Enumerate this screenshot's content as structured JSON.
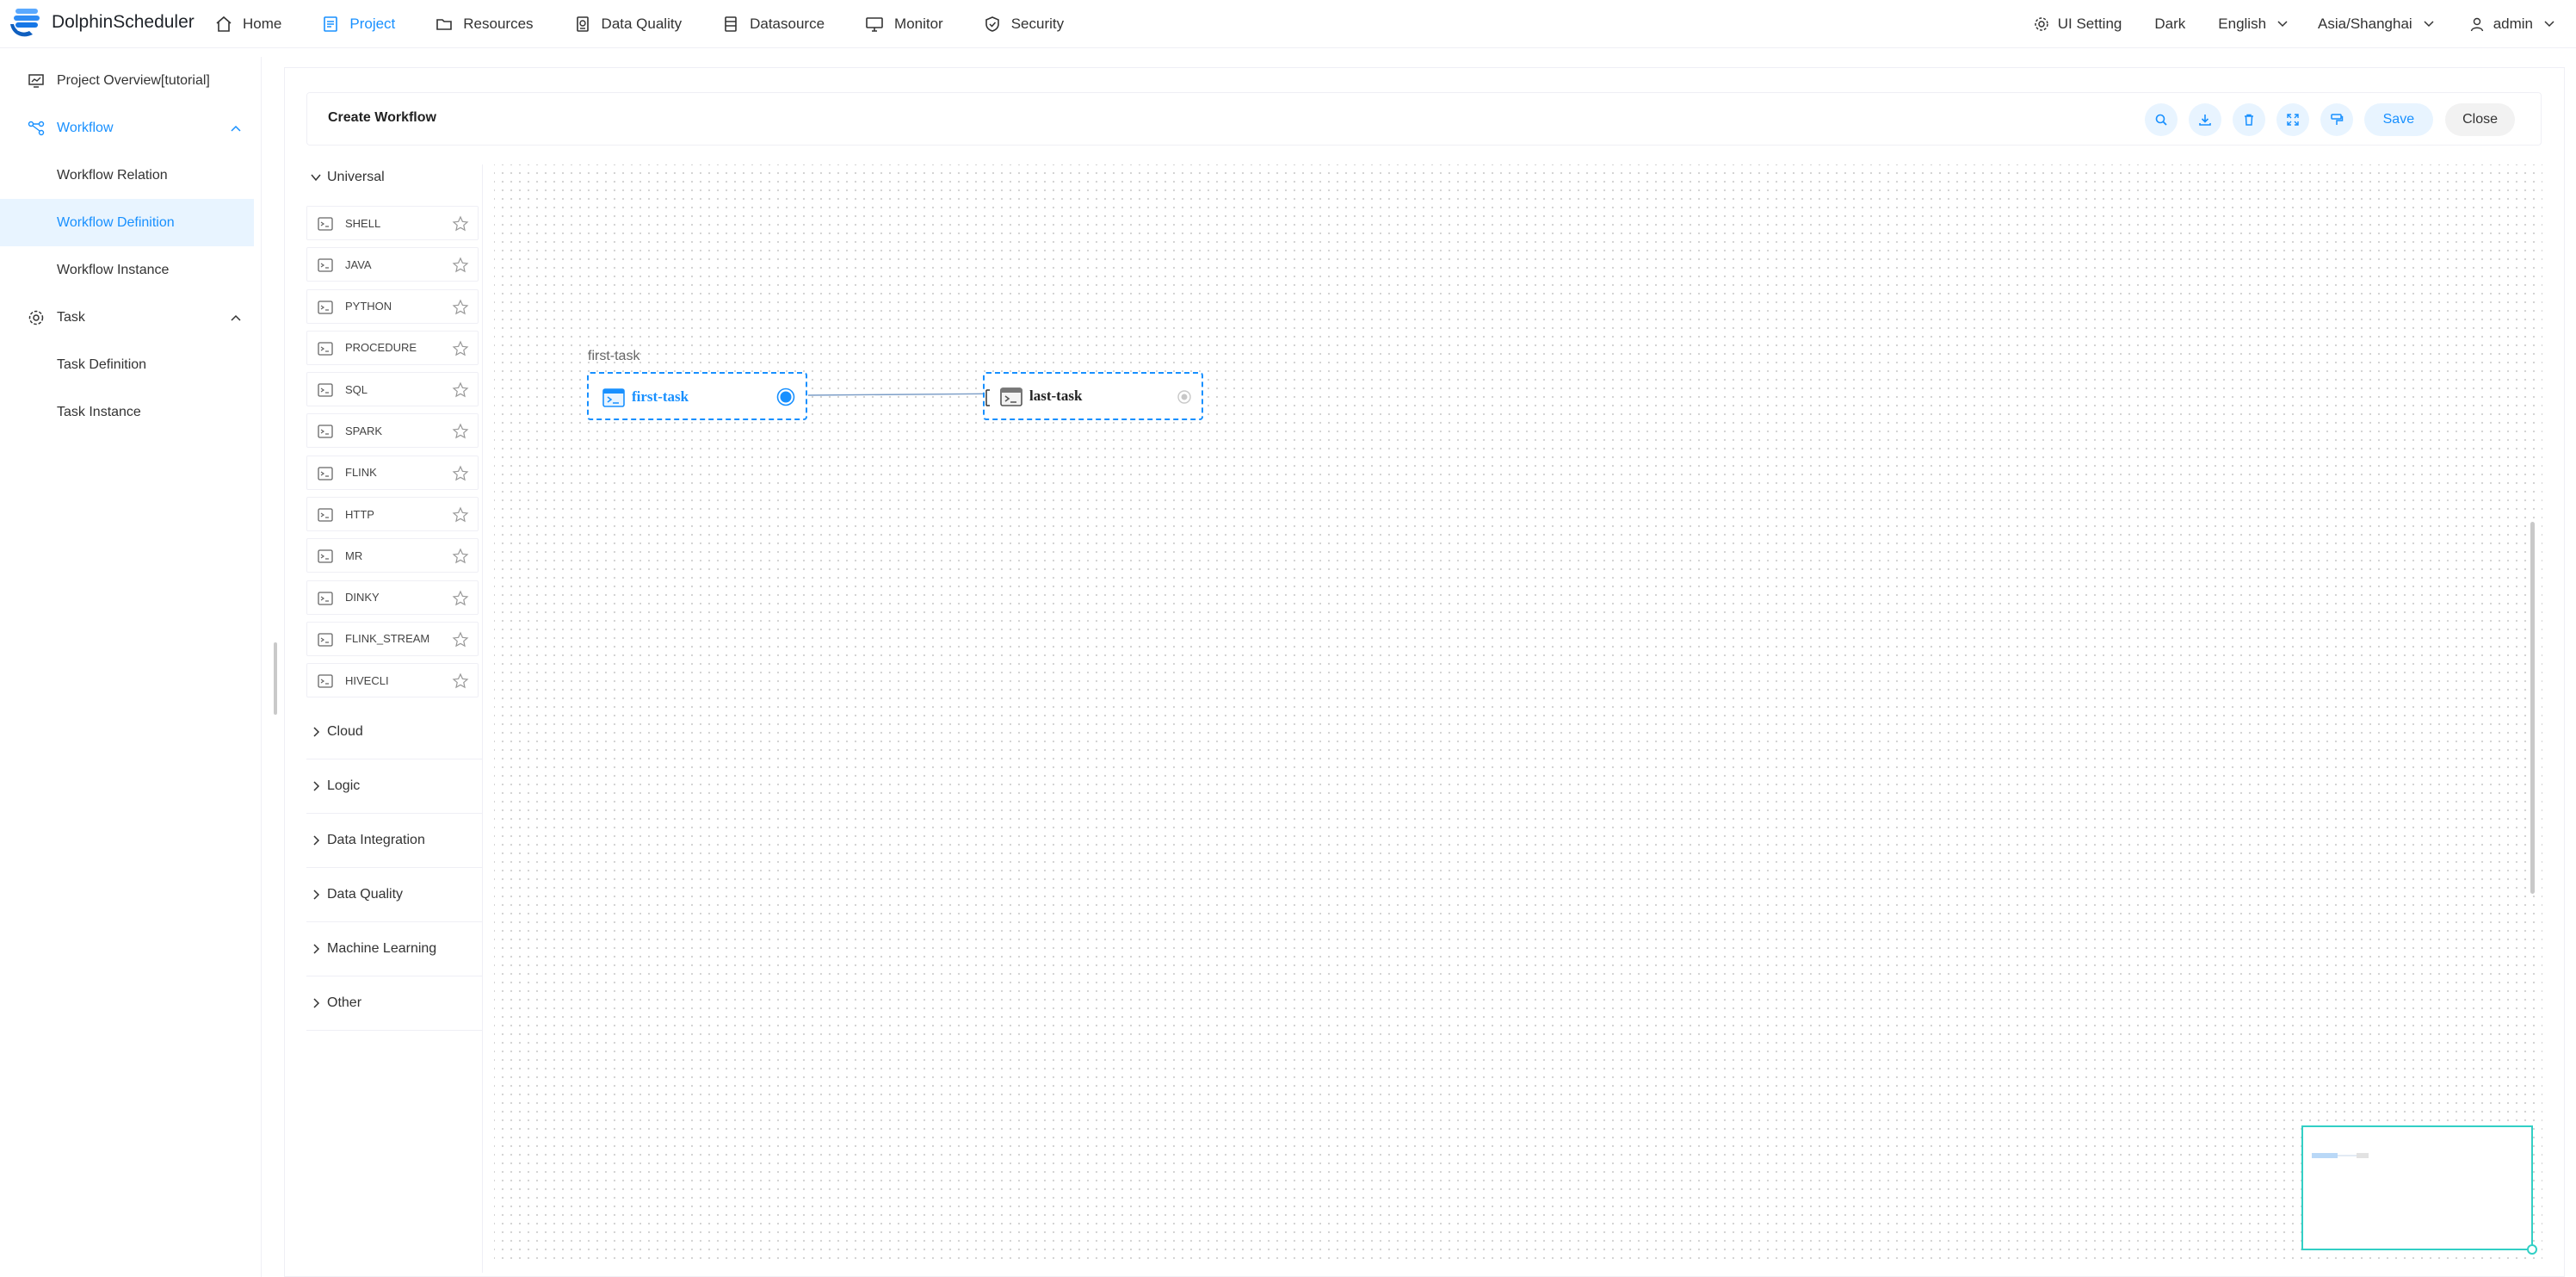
{
  "app": {
    "name": "DolphinScheduler"
  },
  "nav": {
    "items": [
      {
        "label": "Home",
        "icon": "home-icon",
        "active": false
      },
      {
        "label": "Project",
        "icon": "project-icon",
        "active": true
      },
      {
        "label": "Resources",
        "icon": "folder-icon",
        "active": false
      },
      {
        "label": "Data Quality",
        "icon": "data-quality-icon",
        "active": false
      },
      {
        "label": "Datasource",
        "icon": "database-icon",
        "active": false
      },
      {
        "label": "Monitor",
        "icon": "monitor-icon",
        "active": false
      },
      {
        "label": "Security",
        "icon": "shield-icon",
        "active": false
      }
    ],
    "ui_setting": "UI Setting",
    "theme": "Dark",
    "language": "English",
    "timezone": "Asia/Shanghai",
    "user": "admin"
  },
  "sidebar": {
    "project_overview": "Project Overview[tutorial]",
    "workflow": "Workflow",
    "workflow_relation": "Workflow Relation",
    "workflow_definition": "Workflow Definition",
    "workflow_instance": "Workflow Instance",
    "task": "Task",
    "task_definition": "Task Definition",
    "task_instance": "Task Instance"
  },
  "editor": {
    "title": "Create Workflow",
    "save_label": "Save",
    "close_label": "Close",
    "tool_icons": [
      "search-icon",
      "download-icon",
      "delete-icon",
      "fullscreen-icon",
      "format-icon"
    ]
  },
  "palette": {
    "universal": "Universal",
    "tasks": [
      {
        "label": "SHELL",
        "icon": "shell-icon"
      },
      {
        "label": "JAVA",
        "icon": "java-icon"
      },
      {
        "label": "PYTHON",
        "icon": "python-icon"
      },
      {
        "label": "PROCEDURE",
        "icon": "procedure-icon"
      },
      {
        "label": "SQL",
        "icon": "sql-icon"
      },
      {
        "label": "SPARK",
        "icon": "spark-icon"
      },
      {
        "label": "FLINK",
        "icon": "flink-icon"
      },
      {
        "label": "HTTP",
        "icon": "http-icon"
      },
      {
        "label": "MR",
        "icon": "mr-icon"
      },
      {
        "label": "DINKY",
        "icon": "dinky-icon"
      },
      {
        "label": "FLINK_STREAM",
        "icon": "flink-stream-icon"
      },
      {
        "label": "HIVECLI",
        "icon": "hivecli-icon"
      }
    ],
    "categories": [
      "Cloud",
      "Logic",
      "Data Integration",
      "Data Quality",
      "Machine Learning",
      "Other"
    ]
  },
  "canvas": {
    "caption": "first-task",
    "nodes": [
      {
        "label": "first-task",
        "icon": "shell-icon"
      },
      {
        "label": "last-task",
        "icon": "shell-icon"
      }
    ]
  },
  "colors": {
    "accent": "#1890ff",
    "accent_bg": "#e8f4ff",
    "minimap": "#32cfc5"
  }
}
